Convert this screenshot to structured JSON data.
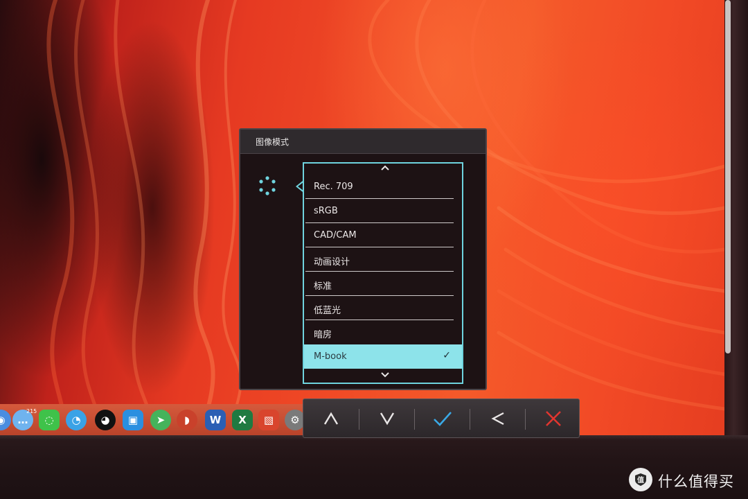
{
  "osd": {
    "title": "图像模式",
    "icon": "picture-mode-dots-icon",
    "scroll_up_icon": "chevron-up-icon",
    "scroll_down_icon": "chevron-down-icon",
    "modes": [
      {
        "label": "Rec. 709"
      },
      {
        "label": "sRGB"
      },
      {
        "label": "CAD/CAM"
      },
      {
        "label": "动画设计"
      },
      {
        "label": "标准"
      },
      {
        "label": "低蓝光"
      },
      {
        "label": "暗房"
      },
      {
        "label": "M-book",
        "selected": true,
        "check": "✓"
      }
    ],
    "colors": {
      "accent": "#6fd4df",
      "selected_bg": "#8de3ea",
      "panel_bg": "#1d1214"
    }
  },
  "controls": {
    "buttons": [
      {
        "icon": "chevron-up-icon",
        "glyph": "∧"
      },
      {
        "icon": "chevron-down-icon",
        "glyph": "∨"
      },
      {
        "icon": "checkmark-icon",
        "glyph": "✓"
      },
      {
        "icon": "chevron-left-icon",
        "glyph": "<"
      },
      {
        "icon": "close-icon",
        "glyph": "✕"
      }
    ]
  },
  "dock": {
    "badge": "215",
    "icons": [
      "safari-icon",
      "messages-icon",
      "wechat-icon",
      "qq-browser-icon",
      "qq-icon",
      "tencent-app-icon",
      "telegram-icon",
      "browser-dog-icon",
      "word-icon",
      "excel-icon",
      "remote-desktop-icon",
      "system-preferences-icon"
    ]
  },
  "watermark": {
    "logo": "值",
    "text": "什么值得买"
  }
}
